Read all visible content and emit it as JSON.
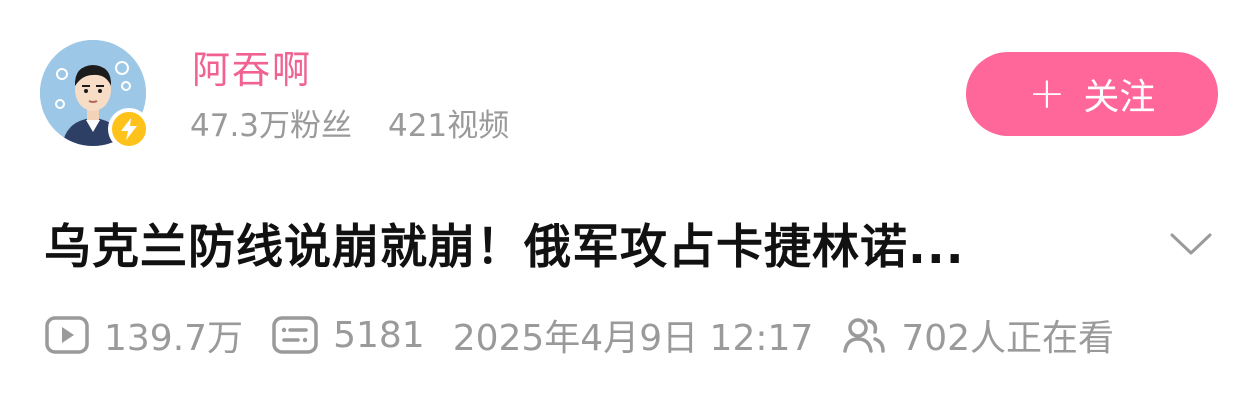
{
  "author": {
    "name": "阿吞啊",
    "followers": "47.3万粉丝",
    "videos": "421视频"
  },
  "follow_button": {
    "plus": "+",
    "label": "关注"
  },
  "video": {
    "title": "乌克兰防线说崩就崩！俄军攻占卡捷林诺...",
    "views": "139.7万",
    "danmaku": "5181",
    "published": "2025年4月9日 12:17",
    "watching": "702人正在看"
  },
  "icons": {
    "avatar_badge": "lightning-icon",
    "expand": "chevron-down-icon",
    "views": "play-icon",
    "danmaku": "danmaku-icon",
    "watching": "viewers-icon"
  },
  "colors": {
    "accent": "#ff6699",
    "author_name": "#f06292",
    "meta_gray": "#9a9a9a",
    "badge": "#ffc21a"
  }
}
